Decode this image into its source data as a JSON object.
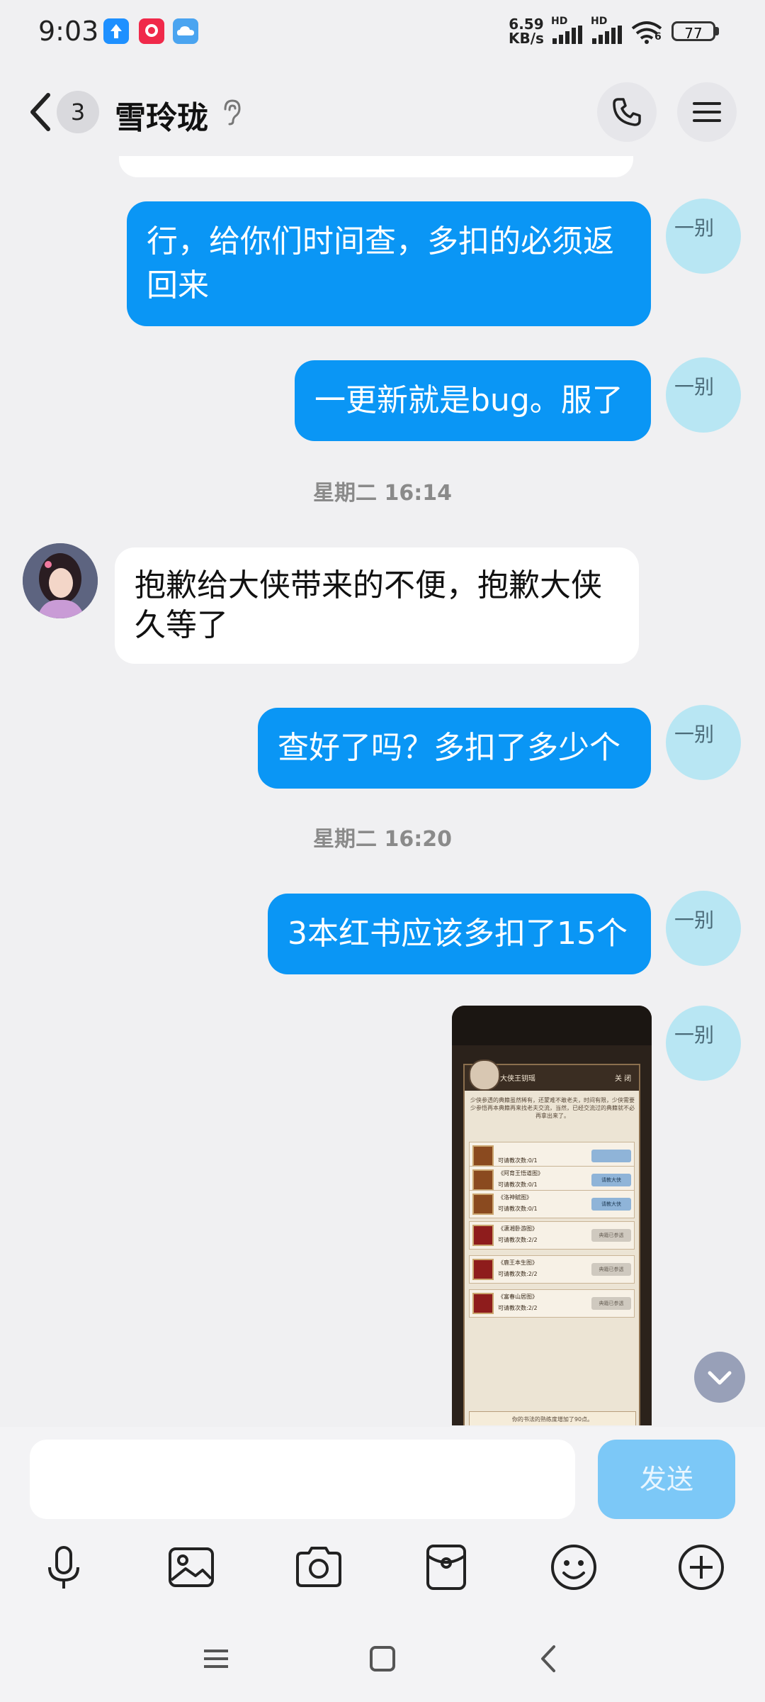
{
  "status_bar": {
    "time": "9:03",
    "net_speed_value": "6.59",
    "net_speed_unit": "KB/s",
    "hd1": "HD",
    "hd2": "HD",
    "wifi_suffix": "6",
    "battery": "77"
  },
  "header": {
    "unread_count": "3",
    "contact_name": "雪玲珑"
  },
  "messages": [
    {
      "dir": "out",
      "text": "行，给你们时间查，多扣的必须返回来"
    },
    {
      "dir": "out",
      "text": "一更新就是bug。服了"
    },
    {
      "type": "time",
      "text": "星期二 16:14"
    },
    {
      "dir": "in",
      "text": "抱歉给大侠带来的不便，抱歉大侠久等了"
    },
    {
      "dir": "out",
      "text": "查好了吗？多扣了多少个"
    },
    {
      "type": "time",
      "text": "星期二 16:20"
    },
    {
      "dir": "out",
      "text": "3本红书应该多扣了15个"
    }
  ],
  "self_avatar_text": "一别",
  "screenshot": {
    "title": "大侠王钥瑶",
    "close": "关 闭",
    "desc": "少侠参透的典籍虽然稀有，还蒙难不敢老夫，时间有限，少侠需要少参悟再本典籍再来找老夫交流，当然，已经交流过的典籍就不必再拿出来了。",
    "rows": [
      {
        "name": "",
        "count": "可请教次数:0/1",
        "btn": ""
      },
      {
        "name": "《阿育王悟道图》",
        "count": "可请教次数:0/1",
        "btn": "请教大侠"
      },
      {
        "name": "《洛神赋图》",
        "count": "可请教次数:0/1",
        "btn": "请教大侠"
      },
      {
        "name": "《潇湘卧游图》",
        "count": "可请教次数:2/2",
        "btn": "典籍已参透"
      },
      {
        "name": "《鹿王本生图》",
        "count": "可请教次数:2/2",
        "btn": "典籍已参透"
      },
      {
        "name": "《富春山居图》",
        "count": "可请教次数:2/2",
        "btn": "典籍已参透"
      }
    ],
    "footer": "你的书法的熟练度增加了90点。"
  },
  "input": {
    "placeholder": "",
    "send_label": "发送"
  },
  "icons": {
    "back": "back-chevron-icon",
    "ear": "ear-icon",
    "phone": "phone-icon",
    "menu": "menu-icon",
    "mic": "microphone-icon",
    "image": "image-icon",
    "camera": "camera-icon",
    "pocket": "red-packet-icon",
    "emoji": "emoji-icon",
    "plus": "plus-icon"
  },
  "colors": {
    "outgoing_bubble": "#0a96f5",
    "incoming_bubble": "#ffffff",
    "background": "#f0f0f2",
    "send_button": "#7cc8f7"
  }
}
